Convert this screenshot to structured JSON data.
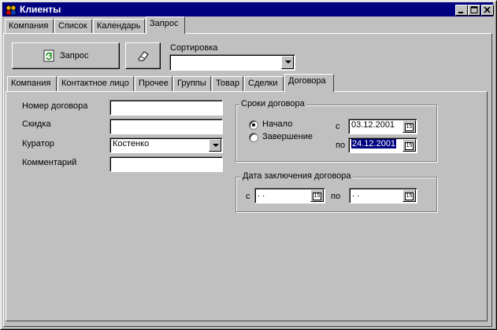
{
  "window": {
    "title": "Клиенты"
  },
  "top_tabs": [
    "Компания",
    "Список",
    "Календарь",
    "Запрос"
  ],
  "toolbar": {
    "query_button": "Запрос",
    "sort_label": "Сортировка",
    "sort_value": ""
  },
  "sub_tabs": [
    "Компания",
    "Контактное лицо",
    "Прочее",
    "Группы",
    "Товар",
    "Сделки",
    "Договора"
  ],
  "form": {
    "contract_number_label": "Номер договора",
    "contract_number_value": "",
    "discount_label": "Скидка",
    "discount_value": "",
    "curator_label": "Куратор",
    "curator_value": "Костенко",
    "comment_label": "Комментарий",
    "comment_value": ""
  },
  "terms": {
    "title": "Сроки договора",
    "radio_start": "Начало",
    "radio_end": "Завершение",
    "from_label": "с",
    "to_label": "по",
    "from_value": "03.12.2001",
    "to_value": "24.12.2001",
    "cal_glyph": "15"
  },
  "signing": {
    "title": "Дата заключения договора",
    "from_label": "с",
    "to_label": "по",
    "from_value": " .  .",
    "to_value": " .  .",
    "cal_glyph": "15"
  },
  "colors": {
    "titlebar": "#000080",
    "face": "#c0c0c0",
    "selection": "#000080"
  }
}
